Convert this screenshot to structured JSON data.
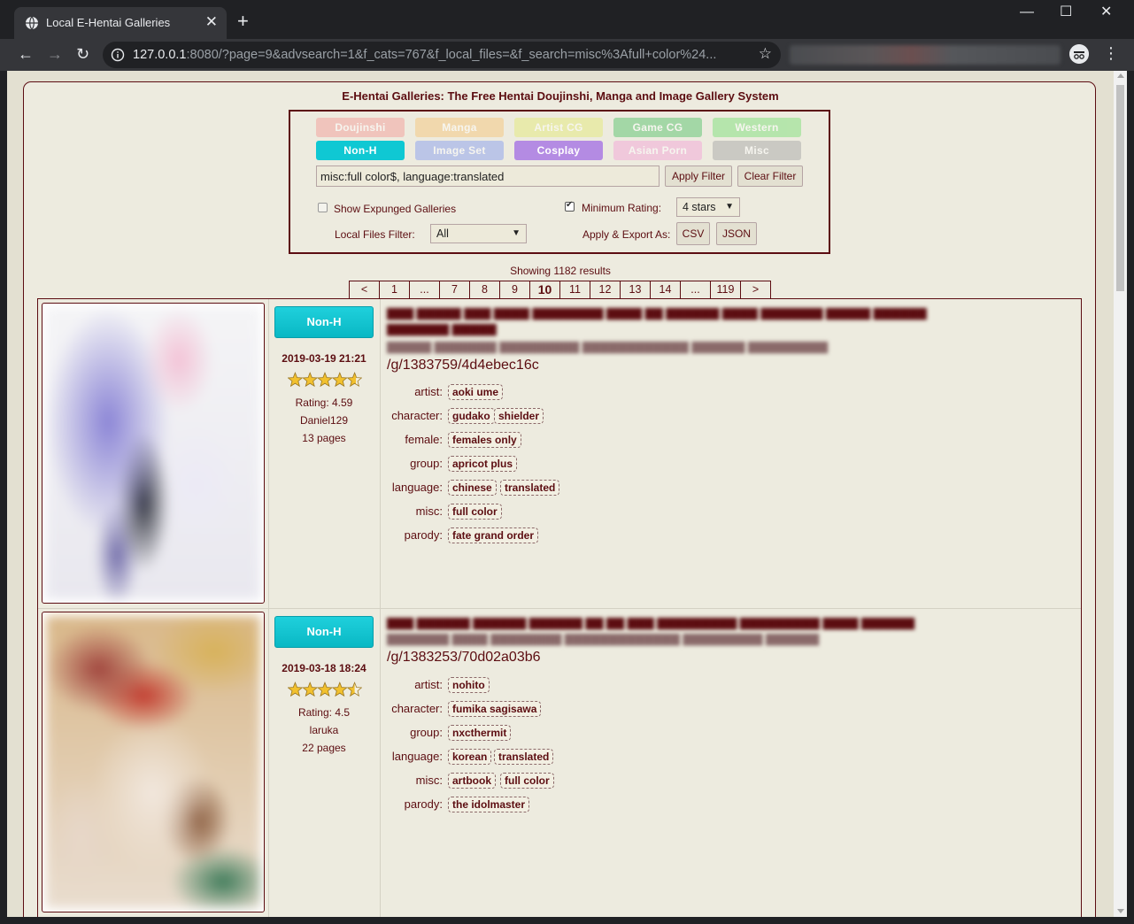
{
  "browser": {
    "tab_title": "Local E-Hentai Galleries",
    "url_host": "127.0.0.1",
    "url_rest": ":8080/?page=9&advsearch=1&f_cats=767&f_local_files=&f_search=misc%3Afull+color%24...",
    "new_tab": "+",
    "tab_close": "✕",
    "win_minimize": "—",
    "win_maximize": "☐",
    "win_close": "✕"
  },
  "site": {
    "title": "E-Hentai Galleries: The Free Hentai Doujinshi, Manga and Image Gallery System"
  },
  "categories": [
    {
      "label": "Doujinshi",
      "color": "#f49f9a",
      "active": false
    },
    {
      "label": "Manga",
      "color": "#f5c67d",
      "active": false
    },
    {
      "label": "Artist CG",
      "color": "#e4ea7a",
      "active": false
    },
    {
      "label": "Game CG",
      "color": "#5cc56e",
      "active": false
    },
    {
      "label": "Western",
      "color": "#7fe07a",
      "active": false
    },
    {
      "label": "Non-H",
      "color": "#0fc8d3",
      "active": true
    },
    {
      "label": "Image Set",
      "color": "#8ba0f0",
      "active": false
    },
    {
      "label": "Cosplay",
      "color": "#b48be3",
      "active": true
    },
    {
      "label": "Asian Porn",
      "color": "#f3a6d9",
      "active": false
    },
    {
      "label": "Misc",
      "color": "#a8a8a8",
      "active": false
    }
  ],
  "search": {
    "value": "misc:full color$, language:translated",
    "apply_label": "Apply Filter",
    "clear_label": "Clear Filter",
    "show_expunged_label": "Show Expunged Galleries",
    "show_expunged_checked": false,
    "min_rating_label": "Minimum Rating:",
    "min_rating_checked": true,
    "min_rating_value": "4 stars",
    "local_files_label": "Local Files Filter:",
    "local_files_value": "All",
    "export_label": "Apply & Export As:",
    "csv_label": "CSV",
    "json_label": "JSON"
  },
  "results": {
    "count_text": "Showing 1182 results"
  },
  "pagination": [
    "<",
    "1",
    "...",
    "7",
    "8",
    "9",
    "10",
    "11",
    "12",
    "13",
    "14",
    "...",
    "119",
    ">"
  ],
  "pagination_current": "10",
  "galleries": [
    {
      "category": "Non-H",
      "posted": "2019-03-19 21:21",
      "rating_text": "Rating: 4.59",
      "rating": 4.59,
      "uploader": "Daniel129",
      "pages": "13 pages",
      "link": "/g/1383759/4d4ebec16c",
      "tags": [
        {
          "ns": "artist:",
          "values": [
            "aoki ume"
          ]
        },
        {
          "ns": "character:",
          "values": [
            "gudako",
            "shielder"
          ]
        },
        {
          "ns": "female:",
          "values": [
            "females only"
          ]
        },
        {
          "ns": "group:",
          "values": [
            "apricot plus"
          ]
        },
        {
          "ns": "language:",
          "values": [
            "chinese",
            "translated"
          ]
        },
        {
          "ns": "misc:",
          "values": [
            "full color"
          ]
        },
        {
          "ns": "parody:",
          "values": [
            "fate grand order"
          ]
        }
      ]
    },
    {
      "category": "Non-H",
      "posted": "2019-03-18 18:24",
      "rating_text": "Rating: 4.5",
      "rating": 4.5,
      "uploader": "laruka",
      "pages": "22 pages",
      "link": "/g/1383253/70d02a03b6",
      "tags": [
        {
          "ns": "artist:",
          "values": [
            "nohito"
          ]
        },
        {
          "ns": "character:",
          "values": [
            "fumika sagisawa"
          ]
        },
        {
          "ns": "group:",
          "values": [
            "nxcthermit"
          ]
        },
        {
          "ns": "language:",
          "values": [
            "korean",
            "translated"
          ]
        },
        {
          "ns": "misc:",
          "values": [
            "artbook",
            "full color"
          ]
        },
        {
          "ns": "parody:",
          "values": [
            "the idolmaster"
          ]
        }
      ]
    }
  ]
}
